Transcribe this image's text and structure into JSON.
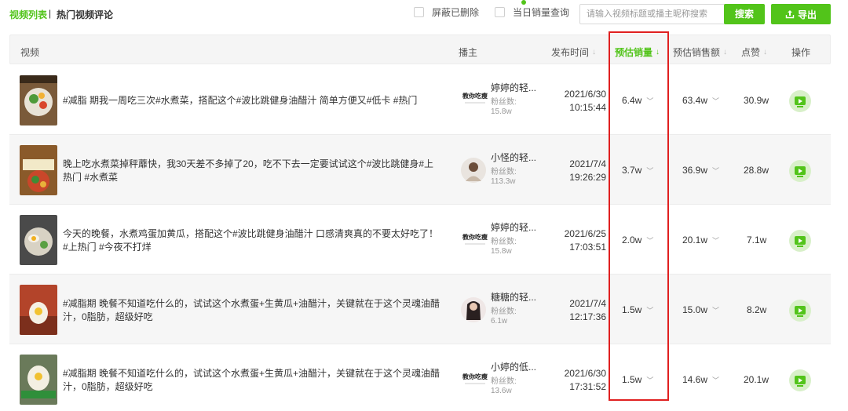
{
  "tabs": {
    "active": "视频列表",
    "separator": "|",
    "other": "热门视频评论"
  },
  "filters": {
    "hide_deleted": "屏蔽已删除",
    "daily_sales": "当日销量查询"
  },
  "search": {
    "placeholder": "请输入视频标题或播主昵称搜索",
    "button": "搜索"
  },
  "export": {
    "label": "导出",
    "icon": "upload-icon"
  },
  "colors": {
    "accent": "#52c41a",
    "highlight": "#e02020"
  },
  "columns": {
    "video": "视频",
    "author": "播主",
    "publish_time": "发布时间",
    "est_sales": "预估销量",
    "est_revenue": "预估销售额",
    "likes": "点赞",
    "action": "操作"
  },
  "fans_label": "粉丝数:",
  "rows": [
    {
      "title": "#减脂 期我一周吃三次#水煮菜，搭配这个#波比跳健身油醋汁 简单方便又#低卡 #热门",
      "author": "婷婷的轻...",
      "author_logo": "教你吃瘦",
      "fans": "15.8w",
      "date": "2021/6/30",
      "time": "10:15:44",
      "sales": "6.4w",
      "revenue": "63.4w",
      "likes": "30.9w"
    },
    {
      "title": "晚上吃水煮菜掉秤蘼快，我30天差不多掉了20，吃不下去一定要试试这个#波比跳健身#上热门 #水煮菜",
      "author": "小怪的轻...",
      "fans": "113.3w",
      "date": "2021/7/4",
      "time": "19:26:29",
      "sales": "3.7w",
      "revenue": "36.9w",
      "likes": "28.8w"
    },
    {
      "title": "今天的晚餐，水煮鸡蛋加黄瓜，搭配这个#波比跳健身油醋汁 口感清爽真的不要太好吃了！#上热门 #今夜不打烊",
      "author": "婷婷的轻...",
      "author_logo": "教你吃瘦",
      "fans": "15.8w",
      "date": "2021/6/25",
      "time": "17:03:51",
      "sales": "2.0w",
      "revenue": "20.1w",
      "likes": "7.1w"
    },
    {
      "title": "#减脂期 晚餐不知道吃什么的，试试这个水煮蛋+生黄瓜+油醋汁，关键就在于这个灵魂油醋汁，0脂肪，超级好吃",
      "author": "糖糖的轻...",
      "fans": "6.1w",
      "date": "2021/7/4",
      "time": "12:17:36",
      "sales": "1.5w",
      "revenue": "15.0w",
      "likes": "8.2w"
    },
    {
      "title": "#减脂期 晚餐不知道吃什么的，试试这个水煮蛋+生黄瓜+油醋汁，关键就在于这个灵魂油醋汁，0脂肪，超级好吃",
      "author": "小婷的低...",
      "author_logo": "教你吃瘦",
      "fans": "13.6w",
      "date": "2021/6/30",
      "time": "17:31:52",
      "sales": "1.5w",
      "revenue": "14.6w",
      "likes": "20.1w"
    }
  ]
}
